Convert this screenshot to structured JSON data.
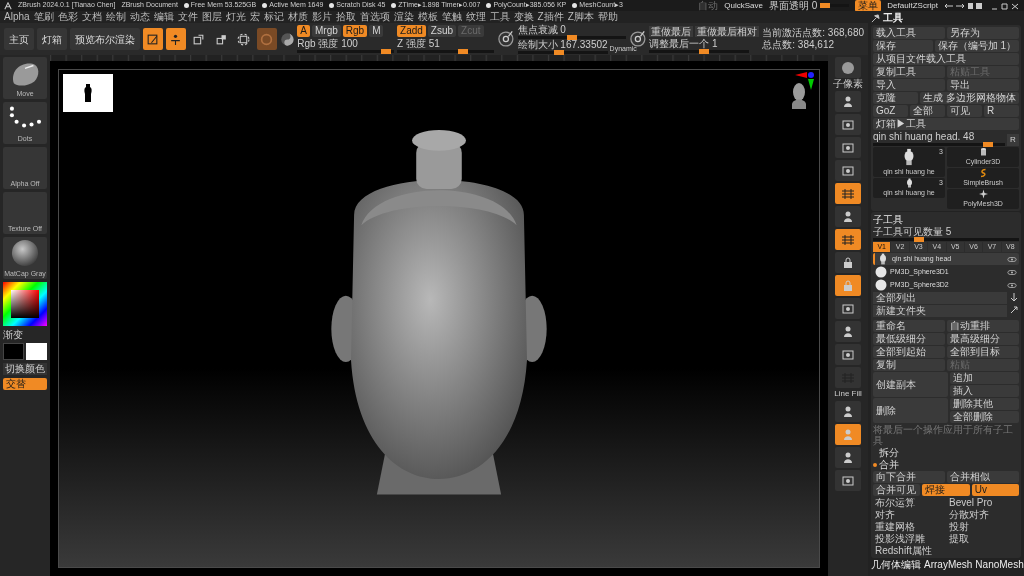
{
  "title_bar": {
    "app": "ZBrush 2024.0.1 [Tianao Chen]",
    "document": "ZBrush Document",
    "stats": [
      "Free Mem 53.525GB",
      "Active Mem 1649",
      "Scratch Disk 45",
      "ZTime▸1.898 Timer▸0.007",
      "PolyCount▸385.056 KP",
      "MeshCount▸3"
    ],
    "autosave": "自动",
    "quicksave": "QuickSave",
    "transparency": {
      "label": "界面透明 0",
      "level": 0.05
    },
    "menu_toggle": {
      "label": "菜单",
      "on": true
    },
    "script": "DefaultZScript"
  },
  "menu_bar": [
    "Alpha",
    "笔刷",
    "色彩",
    "文档",
    "绘制",
    "动态",
    "编辑",
    "文件",
    "图层",
    "灯光",
    "宏",
    "标记",
    "材质",
    "影片",
    "拾取",
    "首选项",
    "渲染",
    "模板",
    "笔触",
    "纹理",
    "工具",
    "变换",
    "Z插件",
    "Z脚本",
    "帮助"
  ],
  "toolbar": {
    "buttons": [
      "主页",
      "灯箱",
      "预览布尔渲染"
    ],
    "modes": [
      {
        "kind": "edit",
        "on": true
      },
      {
        "kind": "draw",
        "on": true
      },
      {
        "kind": "move",
        "on": false
      },
      {
        "kind": "scale",
        "on": false
      },
      {
        "kind": "rotate",
        "on": false
      }
    ],
    "color_modes": [
      {
        "label": "A",
        "on": true,
        "disabled": false
      },
      {
        "label": "Mrgb",
        "on": false,
        "disabled": false
      },
      {
        "label": "Rgb",
        "on": true,
        "disabled": false
      },
      {
        "label": "M",
        "on": false,
        "disabled": false
      }
    ],
    "color_strength": {
      "label": "Rgb 强度 100",
      "level": 0.97
    },
    "z_modes": [
      {
        "label": "Zadd",
        "on": true,
        "disabled": false
      },
      {
        "label": "Zsub",
        "on": false,
        "disabled": false
      },
      {
        "label": "Zcut",
        "on": false,
        "disabled": true
      }
    ],
    "z_strength": {
      "label": "Z 强度 51",
      "level": 0.7
    },
    "focal": {
      "label": "焦点衰减 0",
      "level": 0.5
    },
    "draw_size": {
      "label": "绘制大小 167.33502",
      "level": 0.45
    },
    "dynamic": "Dynamic",
    "redo": [
      "重做最后",
      "重做最后相对"
    ],
    "adjust_last": {
      "label": "调整最后一个 1",
      "level": 0.55
    },
    "stats": [
      "当前激活点数: 368,680",
      "总点数: 384,612"
    ]
  },
  "left_shelf": {
    "tiles": [
      {
        "kind": "brush",
        "label": "Move"
      },
      {
        "kind": "stroke",
        "label": "Dots"
      },
      {
        "kind": "empty",
        "label": "Alpha Off"
      },
      {
        "kind": "empty",
        "label": "Texture Off"
      },
      {
        "kind": "material",
        "label": "MatCap Gray"
      }
    ],
    "gradient": "渐变",
    "switch_color": "切换颜色",
    "alternate": {
      "label": "交替",
      "on": true
    }
  },
  "right_shelf": [
    {
      "kind": "sphere",
      "label": "子像素",
      "on": false
    },
    {
      "kind": "figure",
      "on": false
    },
    {
      "kind": "frame",
      "on": false
    },
    {
      "kind": "frame",
      "on": false
    },
    {
      "kind": "frame",
      "on": false
    },
    {
      "kind": "grid",
      "on": true
    },
    {
      "kind": "figure",
      "on": false
    },
    {
      "kind": "grid",
      "on": true
    },
    {
      "kind": "lock",
      "on": false
    },
    {
      "kind": "lock",
      "on": true
    },
    {
      "kind": "frame",
      "on": false
    },
    {
      "kind": "figure",
      "on": false
    },
    {
      "kind": "frame",
      "on": false
    },
    {
      "kind": "grid",
      "label": "Line Fill",
      "on": false
    },
    {
      "kind": "figure",
      "on": false
    },
    {
      "kind": "figure",
      "on": true
    },
    {
      "kind": "figure",
      "on": false
    },
    {
      "kind": "frame",
      "on": false
    }
  ],
  "tool_panel": {
    "title": "工具",
    "rows": [
      [
        {
          "label": "载入工具",
          "disabled": false
        },
        {
          "label": "另存为",
          "disabled": false
        }
      ],
      [
        {
          "label": "保存",
          "disabled": false
        },
        {
          "label": "保存（编号加 1）",
          "disabled": false
        }
      ],
      [
        {
          "label": "从项目文件载入工具",
          "disabled": false
        }
      ],
      [
        {
          "label": "复制工具",
          "disabled": false
        },
        {
          "label": "粘贴工具",
          "disabled": true
        }
      ],
      [
        {
          "label": "导入",
          "disabled": false
        },
        {
          "label": "导出",
          "disabled": false
        }
      ],
      [
        {
          "label": "克隆",
          "disabled": false
        },
        {
          "label": "生成 多边形网格物体",
          "disabled": false
        }
      ],
      [
        {
          "label": "GoZ",
          "disabled": false
        },
        {
          "label": "全部",
          "disabled": false
        },
        {
          "label": "可见",
          "disabled": false
        },
        {
          "label": "R",
          "disabled": false
        }
      ],
      [
        {
          "label": "灯箱▶工具",
          "disabled": false
        }
      ]
    ],
    "current_tool": {
      "label": "qin shi huang head. 48",
      "level": 0.9,
      "reset": "R"
    },
    "tools_left": [
      {
        "kind": "bust",
        "label": "qin shi huang he",
        "count": "3"
      },
      {
        "kind": "bust",
        "label": "qin shi huang he",
        "count": "3"
      }
    ],
    "tools_right": [
      {
        "kind": "cylinder",
        "label": "Cylinder3D"
      },
      {
        "kind": "brush",
        "label": "SimpleBrush"
      },
      {
        "kind": "star",
        "label": "PolyMesh3D"
      }
    ]
  },
  "subtool": {
    "title": "子工具",
    "visible_count": {
      "label": "子工具可见数量 5",
      "level": 0.3
    },
    "versions": [
      {
        "label": "V1",
        "selected": true
      },
      {
        "label": "V2",
        "selected": false
      },
      {
        "label": "V3",
        "selected": false
      },
      {
        "label": "V4",
        "selected": false
      },
      {
        "label": "V5",
        "selected": false
      },
      {
        "label": "V6",
        "selected": false
      },
      {
        "label": "V7",
        "selected": false
      },
      {
        "label": "V8",
        "selected": false
      }
    ],
    "items": [
      {
        "kind": "bust",
        "name": "qin shi huang head",
        "selected": true
      },
      {
        "kind": "sphere",
        "name": "PM3D_Sphere3D1",
        "selected": false
      },
      {
        "kind": "sphere",
        "name": "PM3D_Sphere3D2",
        "selected": false
      }
    ],
    "list_all": "全部列出",
    "new_folder": "新建文件夹",
    "rows": [
      [
        {
          "label": "重命名",
          "disabled": false
        },
        {
          "label": "自动重排",
          "disabled": false
        }
      ],
      [
        {
          "label": "最低级细分",
          "disabled": false
        },
        {
          "label": "最高级细分",
          "disabled": false
        }
      ],
      [
        {
          "label": "全部到起始",
          "disabled": false
        },
        {
          "label": "全部到目标",
          "disabled": false
        }
      ],
      [
        {
          "label": "复制",
          "disabled": false
        },
        {
          "label": "粘贴",
          "disabled": true
        }
      ]
    ],
    "groups": [
      {
        "label": "创建副本",
        "options": [
          "追加",
          "插入"
        ]
      },
      {
        "label": "删除",
        "options": [
          "删除其他",
          "全部删除"
        ]
      }
    ],
    "note": "将最后一个操作应用于所有子工具",
    "split": {
      "label": "拆分",
      "expanded": false
    },
    "merge": {
      "label": "合并",
      "expanded": true
    },
    "merge_rows": [
      [
        {
          "label": "向下合并",
          "on": false
        },
        {
          "label": "合并相似",
          "on": false
        }
      ],
      [
        {
          "label": "合并可见",
          "on": false
        },
        {
          "label": "焊接",
          "on": true
        },
        {
          "label": "Uv",
          "on": true
        }
      ]
    ],
    "more": [
      "布尔运算",
      "Bevel Pro",
      "对齐",
      "分散对齐",
      "重建网格",
      "投射",
      "投影浅浮雕",
      "提取",
      "Redshift属性"
    ]
  },
  "palettes": [
    "几何体编辑",
    "ArrayMesh",
    "NanoMesh"
  ]
}
